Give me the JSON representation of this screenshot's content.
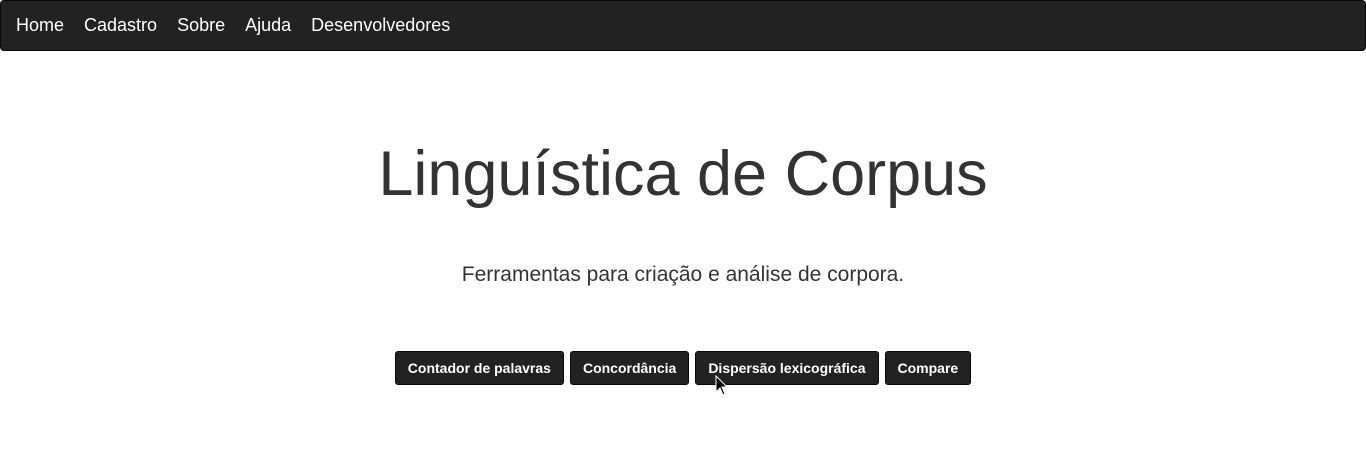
{
  "navbar": {
    "items": [
      "Home",
      "Cadastro",
      "Sobre",
      "Ajuda",
      "Desenvolvedores"
    ]
  },
  "hero": {
    "title": "Linguística de Corpus",
    "subtitle": "Ferramentas para criação e análise de corpora."
  },
  "tools": {
    "buttons": [
      "Contador de palavras",
      "Concordância",
      "Dispersão lexicográfica",
      "Compare"
    ]
  },
  "colors": {
    "navbar_bg": "#222222",
    "button_bg": "#222222",
    "text": "#333333"
  }
}
